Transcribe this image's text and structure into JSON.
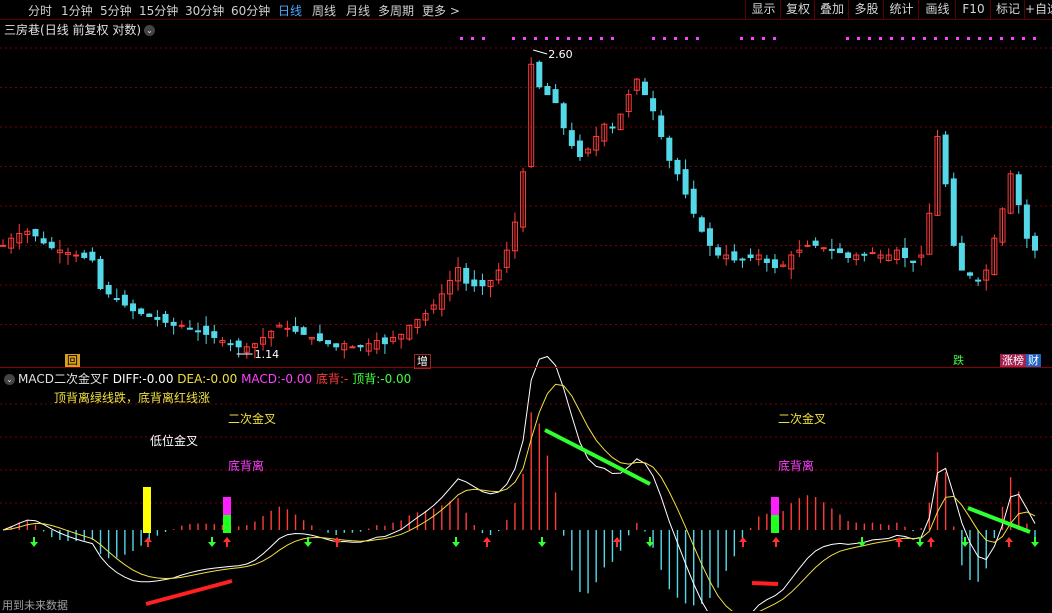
{
  "toolbar": {
    "periods": [
      "分时",
      "1分钟",
      "5分钟",
      "15分钟",
      "30分钟",
      "60分钟",
      "日线",
      "周线",
      "月线",
      "多周期",
      "更多 >"
    ],
    "active_period": "日线",
    "tools": [
      "显示",
      "复权",
      "叠加",
      "多股",
      "统计",
      "画线",
      "F10",
      "标记",
      "+自选"
    ]
  },
  "price_header": {
    "stock": "三房巷",
    "mode": "(日线 前复权 对数)"
  },
  "indicator_header": {
    "name": "MACD二次金叉F",
    "diff_label": "DIFF:",
    "diff_value": "-0.00",
    "dea_label": "DEA:",
    "dea_value": "-0.00",
    "macd_label": "MACD:",
    "macd_value": "-0.00",
    "bottom_div_label": "底背:",
    "bottom_div_value": "-",
    "top_div_label": "顶背:",
    "top_div_value": "-0.00"
  },
  "indicator_note": "顶背离绿线跌，底背离红线涨",
  "annotations": {
    "low_cross": "低位金叉",
    "second_cross_1": "二次金叉",
    "bottom_div_1": "底背离",
    "second_cross_2": "二次金叉",
    "bottom_div_2": "底背离"
  },
  "tags": {
    "hui": "回",
    "zeng": "增",
    "die": "跌",
    "zhangbang": "涨榜",
    "cai": "财"
  },
  "footer": "用到未来数据",
  "colors": {
    "up": "#ff3c3c",
    "down": "#54d8e8",
    "diff": "#ffffff",
    "dea": "#f0e040",
    "macd": "#ff40ff",
    "grid": "#7a0000"
  },
  "chart_data": {
    "type": "candlestick",
    "scale": "log",
    "price_markers": {
      "high": 2.6,
      "low": 1.14
    },
    "close_path": [
      1.52,
      1.55,
      1.57,
      1.58,
      1.56,
      1.53,
      1.51,
      1.5,
      1.49,
      1.48,
      1.47,
      1.46,
      1.35,
      1.33,
      1.31,
      1.29,
      1.27,
      1.26,
      1.25,
      1.24,
      1.23,
      1.22,
      1.22,
      1.21,
      1.2,
      1.19,
      1.18,
      1.17,
      1.16,
      1.15,
      1.15,
      1.16,
      1.18,
      1.2,
      1.22,
      1.21,
      1.2,
      1.19,
      1.18,
      1.17,
      1.16,
      1.15,
      1.16,
      1.15,
      1.15,
      1.16,
      1.17,
      1.16,
      1.18,
      1.19,
      1.22,
      1.24,
      1.26,
      1.29,
      1.33,
      1.38,
      1.43,
      1.37,
      1.36,
      1.36,
      1.38,
      1.42,
      1.5,
      1.62,
      1.86,
      2.5,
      2.35,
      2.3,
      2.25,
      2.1,
      2.0,
      1.94,
      1.98,
      2.05,
      2.12,
      2.1,
      2.18,
      2.3,
      2.4,
      2.3,
      2.2,
      2.05,
      1.92,
      1.85,
      1.75,
      1.66,
      1.58,
      1.52,
      1.48,
      1.48,
      1.46,
      1.46,
      1.47,
      1.48,
      1.45,
      1.43,
      1.44,
      1.48,
      1.5,
      1.52,
      1.52,
      1.51,
      1.5,
      1.49,
      1.47,
      1.48,
      1.48,
      1.49,
      1.48,
      1.48,
      1.5,
      1.47,
      1.45,
      1.48,
      1.66,
      2.05,
      1.8,
      1.52,
      1.42,
      1.4,
      1.38,
      1.42,
      1.55,
      1.68,
      1.85,
      1.7,
      1.55,
      1.5
    ],
    "macd_zero": 0
  }
}
